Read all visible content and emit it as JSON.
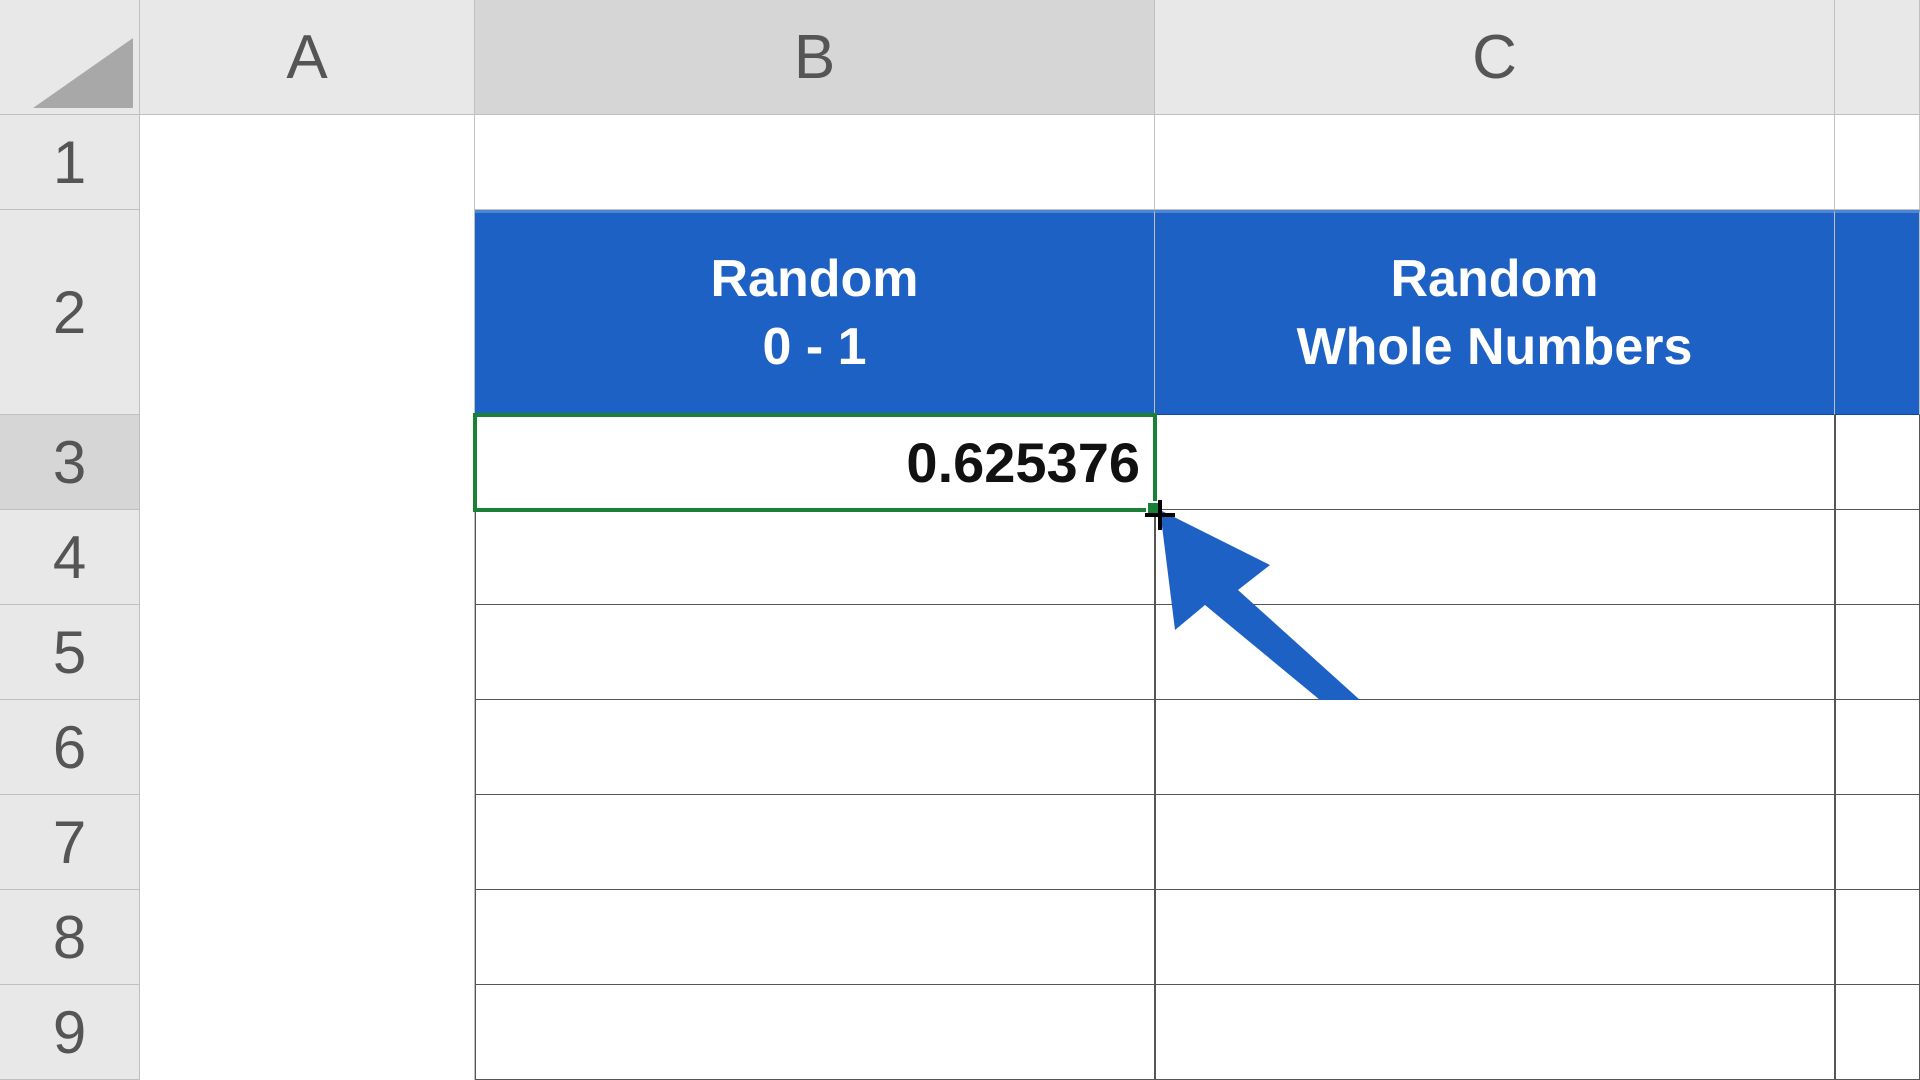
{
  "columns": {
    "A": "A",
    "B": "B",
    "C": "C"
  },
  "rows": {
    "r1": "1",
    "r2": "2",
    "r3": "3",
    "r4": "4",
    "r5": "5",
    "r6": "6",
    "r7": "7",
    "r8": "8",
    "r9": "9"
  },
  "headers": {
    "B": "Random\n0 - 1",
    "C": "Random\nWhole Numbers"
  },
  "cells": {
    "B3": "0.625376",
    "C3": "",
    "B4": "",
    "C4": "",
    "B5": "",
    "C5": "",
    "B6": "",
    "C6": "",
    "B7": "",
    "C7": "",
    "B8": "",
    "C8": "",
    "B9": "",
    "C9": ""
  },
  "selection": {
    "active": "B3",
    "column": "B",
    "row": "3"
  },
  "colors": {
    "header_bg": "#1d61c4",
    "selection": "#1a7f37"
  },
  "chart_data": {
    "type": "table",
    "columns": [
      "Random 0 - 1",
      "Random Whole Numbers"
    ],
    "rows": [
      {
        "Random 0 - 1": 0.625376,
        "Random Whole Numbers": null
      }
    ]
  }
}
